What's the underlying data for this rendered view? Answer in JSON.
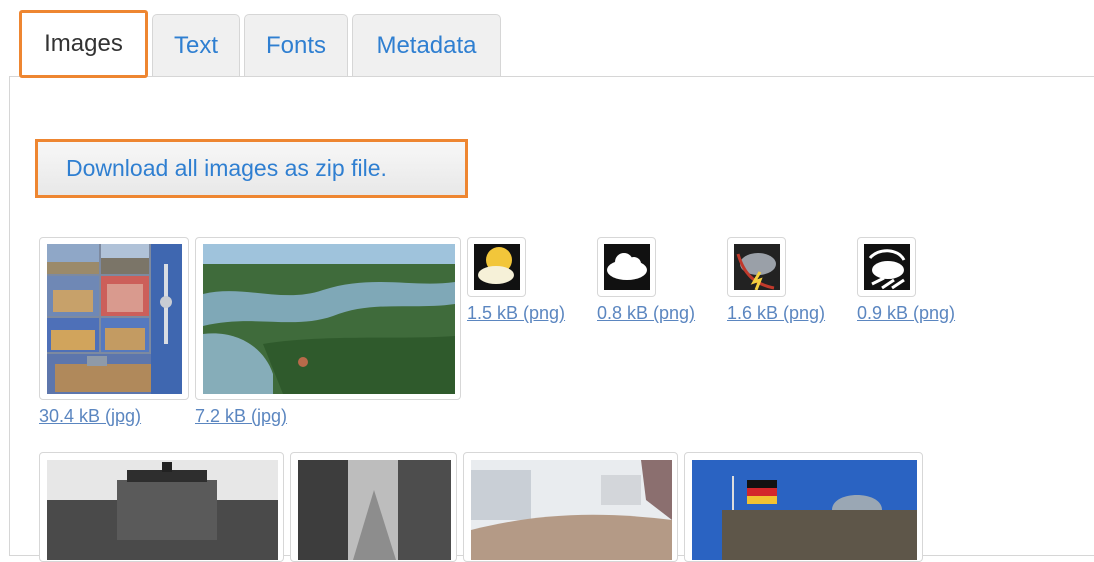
{
  "tabs": [
    {
      "label": "Images",
      "active": true
    },
    {
      "label": "Text",
      "active": false
    },
    {
      "label": "Fonts",
      "active": false
    },
    {
      "label": "Metadata",
      "active": false
    }
  ],
  "download_button": {
    "label": "Download all images as zip file."
  },
  "images_row1": [
    {
      "icon": "berlin-collage",
      "size": "30.4 kB (jpg)"
    },
    {
      "icon": "aerial-lake",
      "size": "7.2 kB (jpg)"
    },
    {
      "icon": "sun-cloud-weather",
      "size": "1.5 kB (png)"
    },
    {
      "icon": "cloud-weather",
      "size": "0.8 kB (png)"
    },
    {
      "icon": "thunderstorm-weather",
      "size": "1.6 kB (png)"
    },
    {
      "icon": "wind-weather",
      "size": "0.9 kB (png)"
    }
  ],
  "images_row2": [
    {
      "icon": "historic-gate-photo"
    },
    {
      "icon": "ruined-street-photo"
    },
    {
      "icon": "winter-wall-photo"
    },
    {
      "icon": "reichstag-flags-photo"
    }
  ],
  "colors": {
    "accent_orange": "#ee8631",
    "link_blue": "#2f7fd1",
    "tab_bg": "#f0f0f0"
  }
}
